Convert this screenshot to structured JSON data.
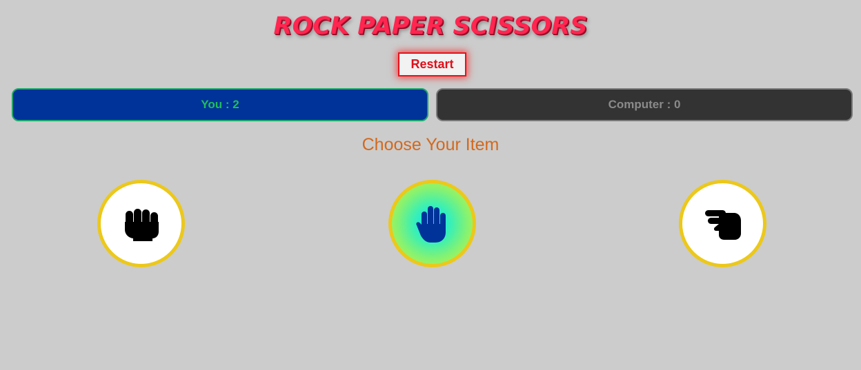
{
  "title": "ROCK PAPER SCISSORS",
  "restart_label": "Restart",
  "scores": {
    "you": "You : 2",
    "computer": "Computer : 0"
  },
  "prompt": "Choose Your Item",
  "choices": [
    {
      "icon": "hand-rock-icon",
      "selected": false
    },
    {
      "icon": "hand-paper-icon",
      "selected": true
    },
    {
      "icon": "hand-scissors-icon",
      "selected": false
    }
  ],
  "colors": {
    "background": "#cccccc",
    "title": "#ff2650",
    "restart": "#e0101a",
    "you_bg": "#003399",
    "you_text": "#1fbf5a",
    "computer_bg": "#333333",
    "computer_text": "#8a8a8a",
    "prompt": "#d2691e",
    "choice_border": "#ecc81a",
    "paper_icon": "#003399"
  }
}
